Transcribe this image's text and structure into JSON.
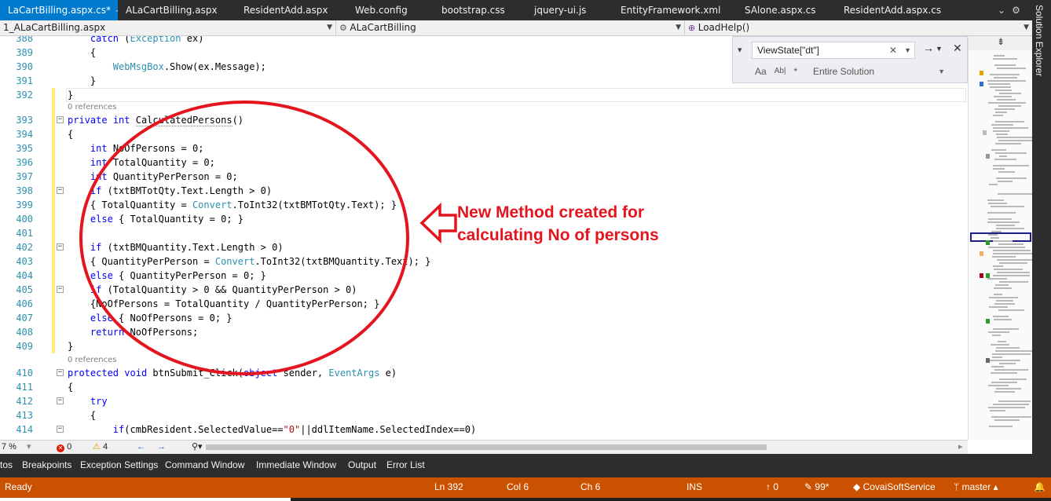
{
  "tabs": [
    {
      "label": "LaCartBilling.aspx.cs*",
      "active": true,
      "width": 150
    },
    {
      "label": "ALaCartBilling.aspx",
      "active": false,
      "width": 150
    },
    {
      "label": "ResidentAdd.aspx",
      "active": false,
      "width": 142
    },
    {
      "label": "Web.config",
      "active": false,
      "width": 110
    },
    {
      "label": "bootstrap.css",
      "active": false,
      "width": 118
    },
    {
      "label": "jquery-ui.js",
      "active": false,
      "width": 110
    },
    {
      "label": "EntityFramework.xml",
      "active": false,
      "width": 158
    },
    {
      "label": "SAlone.aspx.cs",
      "active": false,
      "width": 126
    },
    {
      "label": "ResidentAdd.aspx.cs",
      "active": false,
      "width": 150
    }
  ],
  "tab_icons": {
    "pin": "pin-icon",
    "close": "close-icon",
    "tab_list": "chevron-down-icon",
    "settings": "gear-icon"
  },
  "navbar": {
    "project": "1_ALaCartBilling.aspx",
    "class": "ALaCartBilling",
    "member": "LoadHelp()"
  },
  "find": {
    "query": "ViewState[\"dt\"]",
    "scope": "Entire Solution",
    "options": [
      "Aa",
      "Ab|",
      "*"
    ]
  },
  "solution_explorer": "Solution Explorer",
  "code": {
    "references_label": "0 references",
    "lines": [
      {
        "n": "388",
        "html": "    <span class='kw'>catch</span> (<span class='ty'>Exception</span> ex)"
      },
      {
        "n": "389",
        "html": "    {"
      },
      {
        "n": "390",
        "html": "        <span class='cl'>WebMsgBox</span>.Show(ex.Message);"
      },
      {
        "n": "391",
        "html": "    }"
      },
      {
        "n": "392",
        "html": "}"
      },
      {
        "n": "393",
        "html": "<span class='kw'>private</span> <span class='kw'>int</span> <span class='dotsel'>CalculatedPersons</span>()"
      },
      {
        "n": "394",
        "html": "{"
      },
      {
        "n": "395",
        "html": "    <span class='kw'>int</span> NoOfPersons = 0;"
      },
      {
        "n": "396",
        "html": "    <span class='kw'>int</span> TotalQuantity = 0;"
      },
      {
        "n": "397",
        "html": "    <span class='kw'>int</span> QuantityPerPerson = 0;"
      },
      {
        "n": "398",
        "html": "    <span class='kw'>if</span> (txtBMTotQty.Text.Length > 0)"
      },
      {
        "n": "399",
        "html": "    { TotalQuantity = <span class='cl'>Convert</span>.ToInt32(txtBMTotQty.Text); }"
      },
      {
        "n": "400",
        "html": "    <span class='kw'>else</span> { TotalQuantity = 0; }"
      },
      {
        "n": "401",
        "html": ""
      },
      {
        "n": "402",
        "html": "    <span class='kw'>if</span> (txtBMQuantity.Text.Length > 0)"
      },
      {
        "n": "403",
        "html": "    { QuantityPerPerson = <span class='cl'>Convert</span>.ToInt32(txtBMQuantity.Text); }"
      },
      {
        "n": "404",
        "html": "    <span class='kw'>else</span> { QuantityPerPerson = 0; }"
      },
      {
        "n": "405",
        "html": "    <span class='kw'>if</span> (TotalQuantity > 0 &amp;&amp; QuantityPerPerson > 0)"
      },
      {
        "n": "406",
        "html": "    {NoOfPersons = TotalQuantity / QuantityPerPerson; }"
      },
      {
        "n": "407",
        "html": "    <span class='kw'>else</span> { NoOfPersons = 0; }"
      },
      {
        "n": "408",
        "html": "    <span class='kw'>return</span> NoOfPersons;"
      },
      {
        "n": "409",
        "html": "}"
      },
      {
        "n": "410",
        "html": "<span class='kw'>protected</span> <span class='kw'>void</span> btnSubmit_Click(<span class='kw'>object</span> sender, <span class='cl'>EventArgs</span> e)"
      },
      {
        "n": "411",
        "html": "{"
      },
      {
        "n": "412",
        "html": "    <span class='kw'>try</span>"
      },
      {
        "n": "413",
        "html": "    {"
      },
      {
        "n": "414",
        "html": "        <span class='kw'>if</span>(cmbResident.SelectedValue==<span class='str'>\"0\"</span>||ddlItemName.SelectedIndex==0)"
      }
    ]
  },
  "annotation": {
    "line1": "New Method created for",
    "line2": "calculating No of persons",
    "color": "#e4151f"
  },
  "editor_bottom": {
    "zoom": "7 %",
    "errors": "0",
    "warnings": "4"
  },
  "tool_windows": [
    "tos",
    "Breakpoints",
    "Exception Settings",
    "Command Window",
    "Immediate Window",
    "Output",
    "Error List"
  ],
  "status": {
    "ready": "Ready",
    "ln": "Ln 392",
    "col": "Col 6",
    "ch": "Ch 6",
    "ins": "INS",
    "up": "0",
    "pencil": "99*",
    "repo": "CovaiSoftService",
    "branch": "master",
    "color": "#ca5100"
  }
}
